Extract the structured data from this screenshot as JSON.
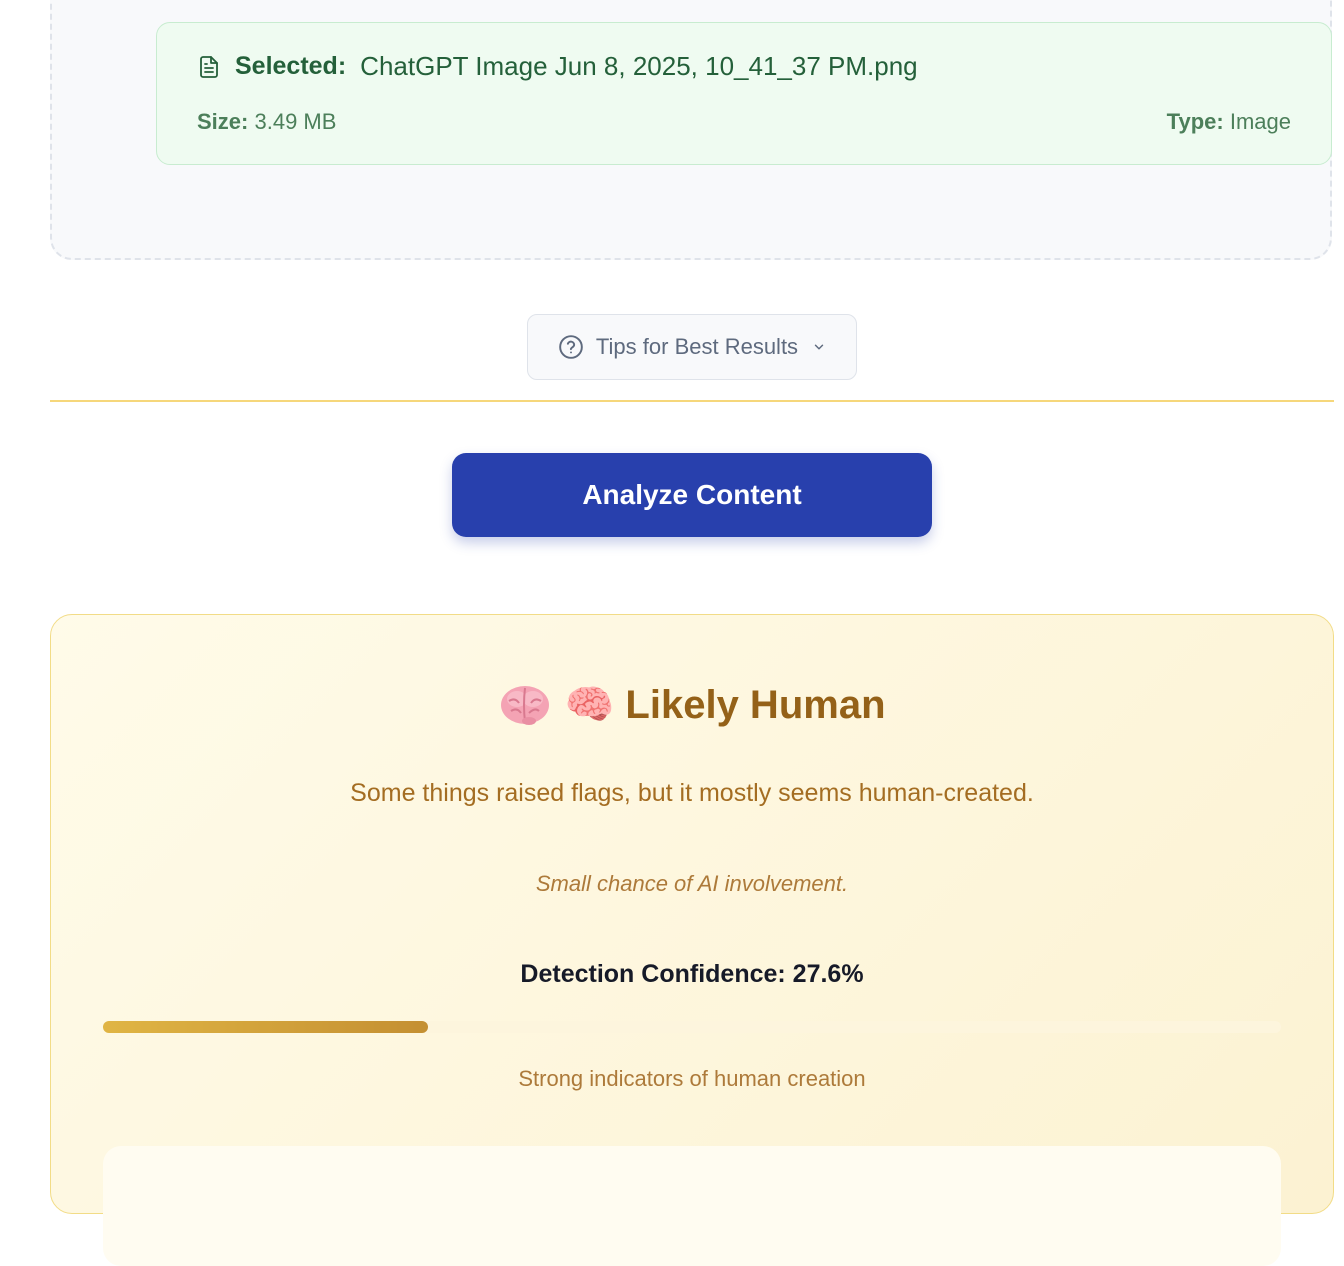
{
  "selected_file": {
    "label": "Selected:",
    "filename": "ChatGPT Image Jun 8, 2025, 10_41_37 PM.png",
    "size_label": "Size:",
    "size_value": "3.49 MB",
    "type_label": "Type:",
    "type_value": "Image",
    "icon": "file-text-icon"
  },
  "tips": {
    "label": "Tips for Best Results",
    "icon": "help-circle-icon",
    "chevron": "chevron-down-icon"
  },
  "analyze_button": {
    "label": "Analyze Content",
    "color": "#2840ad"
  },
  "result": {
    "title": "🧠 Likely Human",
    "icon": "brain-icon",
    "subtitle": "Some things raised flags, but it mostly seems human-created.",
    "note": "Small chance of AI involvement.",
    "confidence_text": "Detection Confidence: 27.6%",
    "confidence_value": 27.6,
    "bar_caption": "Strong indicators of human creation",
    "accent_color": "#946118"
  }
}
